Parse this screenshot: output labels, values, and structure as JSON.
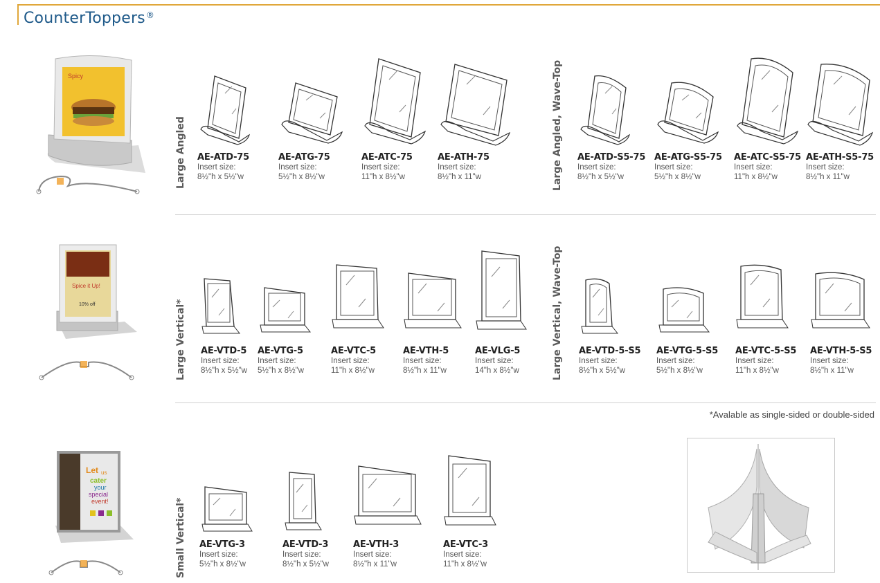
{
  "page_title": "CounterToppers",
  "page_title_mark": "®",
  "footnote": "*Avalable as single-sided or double-sided",
  "sections": [
    {
      "label": "Large Angled"
    },
    {
      "label": "Large Angled, Wave-Top"
    },
    {
      "label": "Large Vertical*"
    },
    {
      "label": "Large Vertical, Wave-Top"
    },
    {
      "label": "Small Vertical*"
    }
  ],
  "row1": [
    {
      "code": "AE-ATD-75",
      "ins_label": "Insert size:",
      "size": "8½\"h x 5½\"w"
    },
    {
      "code": "AE-ATG-75",
      "ins_label": "Insert size:",
      "size": "5½\"h x 8½\"w"
    },
    {
      "code": "AE-ATC-75",
      "ins_label": "Insert size:",
      "size": "11\"h x 8½\"w"
    },
    {
      "code": "AE-ATH-75",
      "ins_label": "Insert size:",
      "size": "8½\"h x 11\"w"
    },
    {
      "code": "AE-ATD-S5-75",
      "ins_label": "Insert size:",
      "size": "8½\"h x 5½\"w"
    },
    {
      "code": "AE-ATG-S5-75",
      "ins_label": "Insert size:",
      "size": "5½\"h x 8½\"w"
    },
    {
      "code": "AE-ATC-S5-75",
      "ins_label": "Insert size:",
      "size": "11\"h x 8½\"w"
    },
    {
      "code": "AE-ATH-S5-75",
      "ins_label": "Insert size:",
      "size": "8½\"h x 11\"w"
    }
  ],
  "row2": [
    {
      "code": "AE-VTD-5",
      "ins_label": "Insert  size:",
      "size": "8½\"h x 5½\"w"
    },
    {
      "code": "AE-VTG-5",
      "ins_label": "Insert size:",
      "size": "5½\"h x 8½\"w"
    },
    {
      "code": "AE-VTC-5",
      "ins_label": "Insert size:",
      "size": "11\"h x 8½\"w"
    },
    {
      "code": "AE-VTH-5",
      "ins_label": "Insert size:",
      "size": "8½\"h x 11\"w"
    },
    {
      "code": "AE-VLG-5",
      "ins_label": "Insert size:",
      "size": "14\"h x 8½\"w"
    },
    {
      "code": "AE-VTD-5-S5",
      "ins_label": "Insert  size:",
      "size": "8½\"h x 5½\"w"
    },
    {
      "code": "AE-VTG-5-S5",
      "ins_label": "Insert size:",
      "size": "5½\"h x 8½\"w"
    },
    {
      "code": "AE-VTC-5-S5",
      "ins_label": "Insert size:",
      "size": "11\"h x 8½\"w"
    },
    {
      "code": "AE-VTH-5-S5",
      "ins_label": "Insert size:",
      "size": "8½\"h x 11\"w"
    }
  ],
  "row3": [
    {
      "code": "AE-VTG-3",
      "ins_label": "Insert size:",
      "size": "5½\"h x 8½\"w"
    },
    {
      "code": "AE-VTD-3",
      "ins_label": "Insert size:",
      "size": "8½\"h x 5½\"w"
    },
    {
      "code": "AE-VTH-3",
      "ins_label": "Insert size:",
      "size": "8½\"h x 11\"w"
    },
    {
      "code": "AE-VTC-3",
      "ins_label": "Insert size:",
      "size": "11\"h x 8½\"w"
    }
  ],
  "thumb2_text": {
    "line1": "Spice it Up!",
    "line2": "10% off"
  },
  "thumb3_text": {
    "line1": "Let",
    "line2": "us",
    "line3": "cater",
    "line4": "your",
    "line5": "special",
    "line6": "event!"
  },
  "colors": {
    "title": "#1f5a8a",
    "accent_rule": "#e0a73a",
    "label": "#5a5a5a"
  }
}
